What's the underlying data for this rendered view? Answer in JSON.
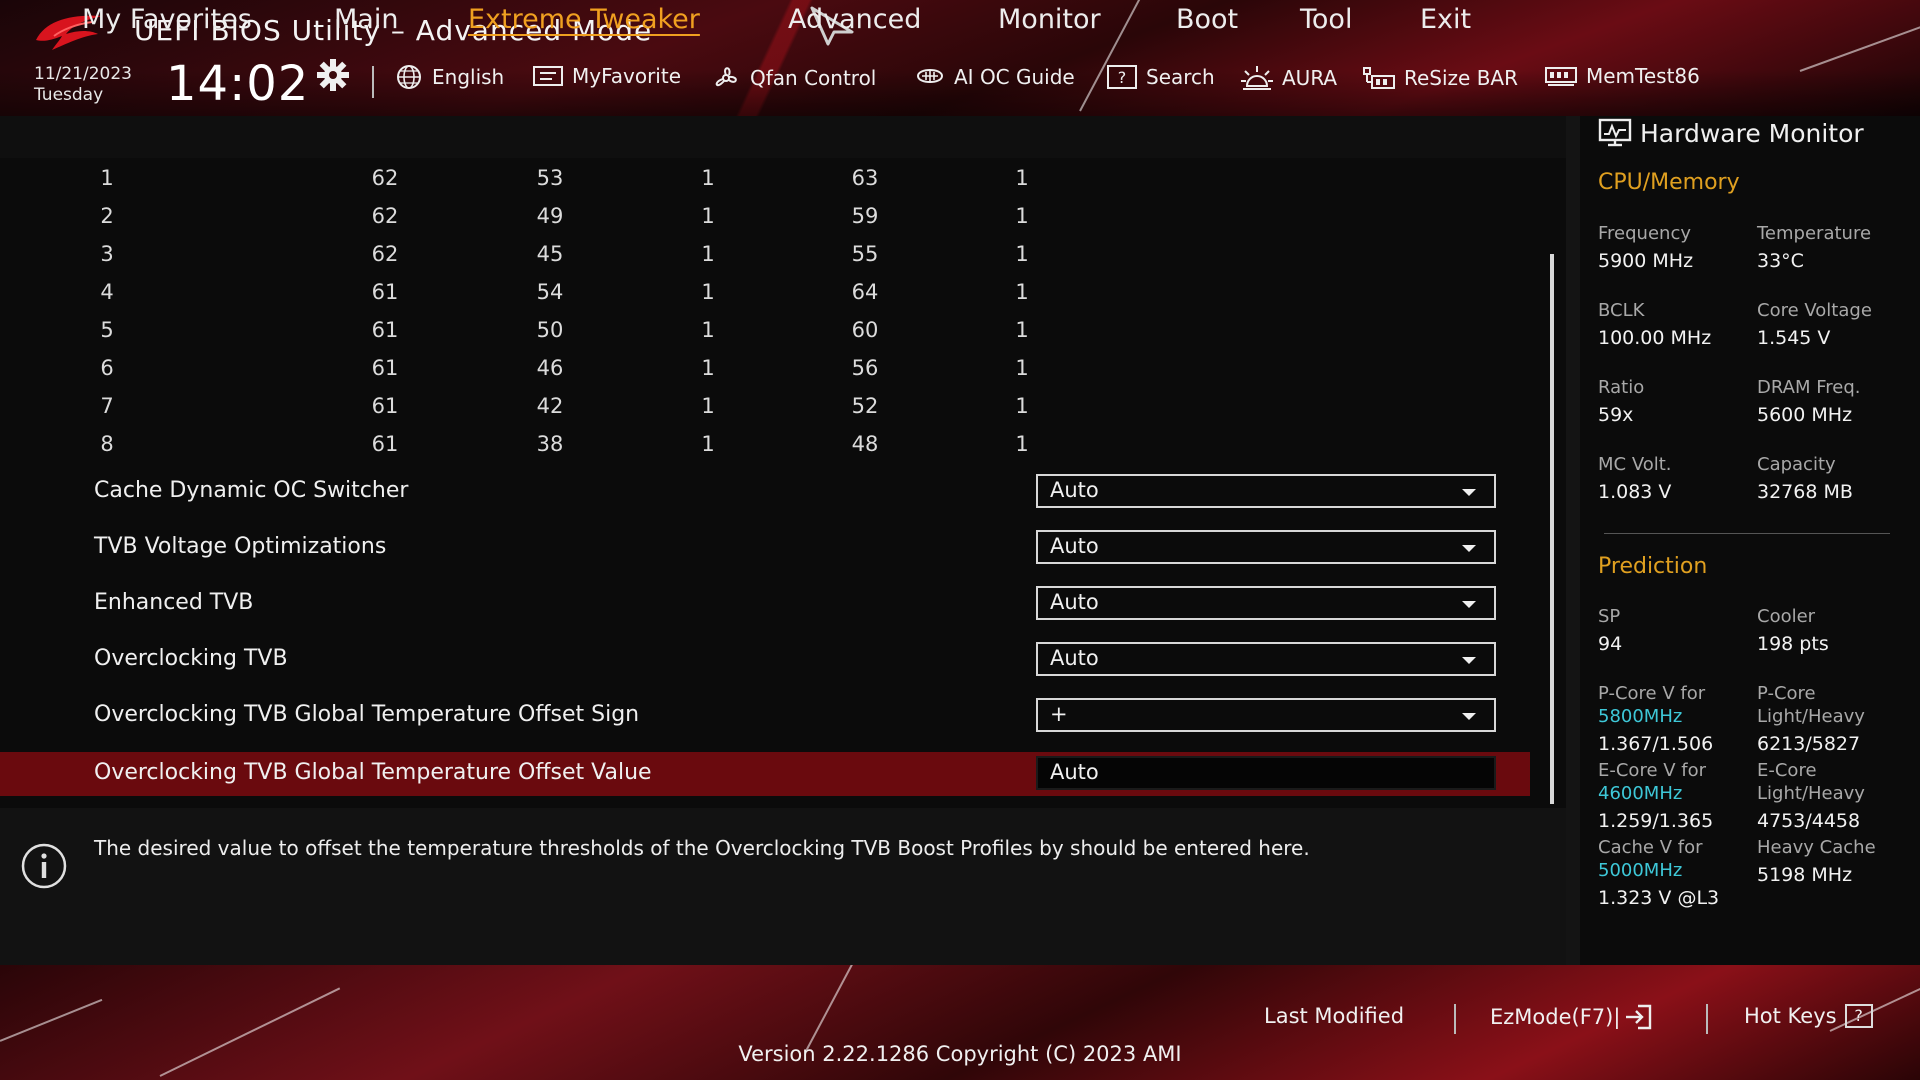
{
  "header": {
    "title": "UEFI BIOS Utility – Advanced Mode",
    "date": "11/21/2023",
    "day": "Tuesday",
    "time": "14:02"
  },
  "toolbar": {
    "items": [
      {
        "label": "English",
        "icon": "globe-icon"
      },
      {
        "label": "MyFavorite",
        "icon": "favorite-list-icon"
      },
      {
        "label": "Qfan Control",
        "icon": "fan-icon"
      },
      {
        "label": "AI OC Guide",
        "icon": "ai-chip-icon"
      },
      {
        "label": "Search",
        "icon": "question-box-icon"
      },
      {
        "label": "AURA",
        "icon": "aura-light-icon"
      },
      {
        "label": "ReSize BAR",
        "icon": "resize-bar-icon"
      },
      {
        "label": "MemTest86",
        "icon": "memory-icon"
      }
    ]
  },
  "nav": {
    "tabs": [
      {
        "label": "My Favorites"
      },
      {
        "label": "Main"
      },
      {
        "label": "Extreme Tweaker"
      },
      {
        "label": "Advanced"
      },
      {
        "label": "Monitor"
      },
      {
        "label": "Boot"
      },
      {
        "label": "Tool"
      },
      {
        "label": "Exit"
      }
    ],
    "active": "Extreme Tweaker"
  },
  "table": {
    "rows": [
      [
        "1",
        "62",
        "53",
        "1",
        "63",
        "1"
      ],
      [
        "2",
        "62",
        "49",
        "1",
        "59",
        "1"
      ],
      [
        "3",
        "62",
        "45",
        "1",
        "55",
        "1"
      ],
      [
        "4",
        "61",
        "54",
        "1",
        "64",
        "1"
      ],
      [
        "5",
        "61",
        "50",
        "1",
        "60",
        "1"
      ],
      [
        "6",
        "61",
        "46",
        "1",
        "56",
        "1"
      ],
      [
        "7",
        "61",
        "42",
        "1",
        "52",
        "1"
      ],
      [
        "8",
        "61",
        "38",
        "1",
        "48",
        "1"
      ]
    ]
  },
  "settings": [
    {
      "label": "Cache Dynamic OC Switcher",
      "value": "Auto"
    },
    {
      "label": "TVB Voltage Optimizations",
      "value": "Auto"
    },
    {
      "label": "Enhanced TVB",
      "value": "Auto"
    },
    {
      "label": "Overclocking TVB",
      "value": "Auto"
    },
    {
      "label": "Overclocking TVB Global Temperature Offset Sign",
      "value": "+"
    },
    {
      "label": "Overclocking TVB Global Temperature Offset Value",
      "value": "Auto"
    }
  ],
  "info": {
    "text": "The desired value to offset the temperature thresholds of the Overclocking TVB Boost Profiles by should  be entered here."
  },
  "hw": {
    "title": "Hardware Monitor",
    "cpu_section": "CPU/Memory",
    "frequency_label": "Frequency",
    "frequency": "5900 MHz",
    "temperature_label": "Temperature",
    "temperature": "33°C",
    "bclk_label": "BCLK",
    "bclk": "100.00 MHz",
    "core_voltage_label": "Core Voltage",
    "core_voltage": "1.545 V",
    "ratio_label": "Ratio",
    "ratio": "59x",
    "dram_label": "DRAM Freq.",
    "dram": "5600 MHz",
    "mc_label": "MC Volt.",
    "mc": "1.083 V",
    "capacity_label": "Capacity",
    "capacity": "32768 MB",
    "prediction_section": "Prediction",
    "sp_label": "SP",
    "sp": "94",
    "cooler_label": "Cooler",
    "cooler": "198 pts",
    "pcore_v_label": "P-Core V for",
    "pcore_v_freq": "5800MHz",
    "pcore_v": "1.367/1.506",
    "pcore_lh_label1": "P-Core",
    "pcore_lh_label2": "Light/Heavy",
    "pcore_lh": "6213/5827",
    "ecore_v_label": "E-Core V for",
    "ecore_v_freq": "4600MHz",
    "ecore_v": "1.259/1.365",
    "ecore_lh_label1": "E-Core",
    "ecore_lh_label2": "Light/Heavy",
    "ecore_lh": "4753/4458",
    "cache_v_label": "Cache V for",
    "cache_v_freq": "5000MHz",
    "cache_v": "1.323 V @L3",
    "heavy_cache_label": "Heavy Cache",
    "heavy_cache": "5198 MHz"
  },
  "footer": {
    "last_modified": "Last Modified",
    "ezmode": "EzMode(F7)|",
    "hotkeys": "Hot Keys",
    "hotkeys_key": "?",
    "version": "Version 2.22.1286 Copyright (C) 2023 AMI"
  },
  "colors": {
    "accent": "#f0a020",
    "highlight_row": "#6a0a0e",
    "frequency_cyan": "#3ec8d8"
  }
}
